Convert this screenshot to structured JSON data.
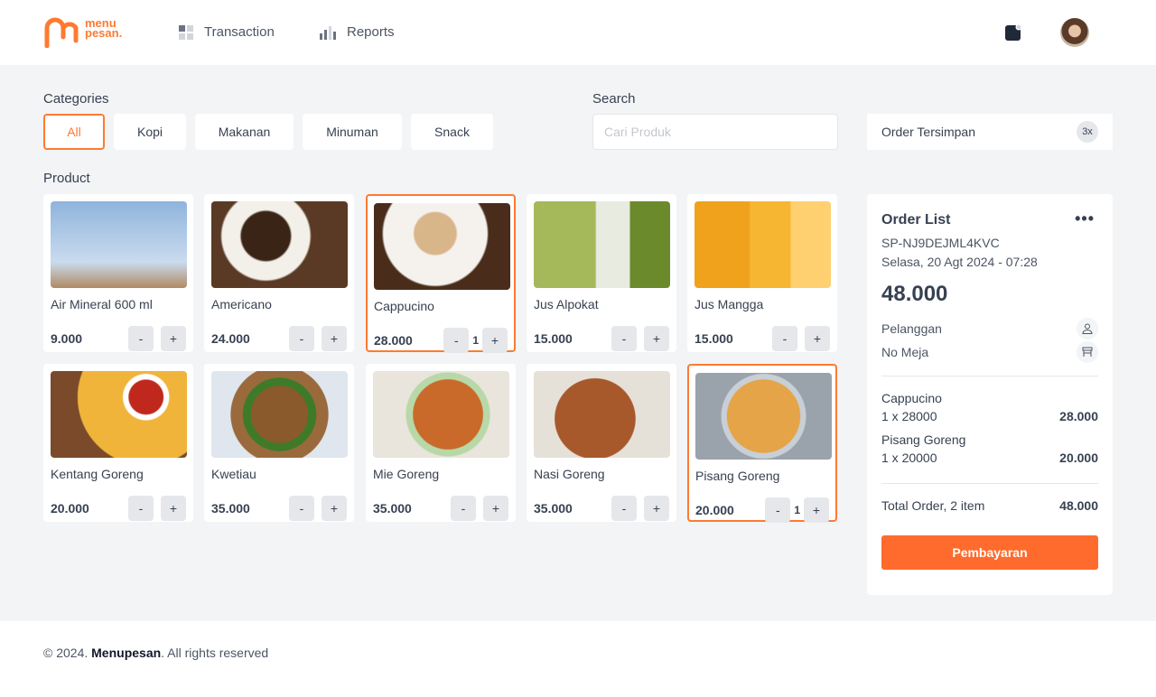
{
  "brand": {
    "logo_text_1": "menu",
    "logo_text_2": "pesan."
  },
  "nav": [
    {
      "label": "Transaction",
      "icon": "grid-icon"
    },
    {
      "label": "Reports",
      "icon": "bar-chart-icon"
    }
  ],
  "categories": {
    "label": "Categories",
    "items": [
      "All",
      "Kopi",
      "Makanan",
      "Minuman",
      "Snack"
    ],
    "active": "All"
  },
  "search": {
    "label": "Search",
    "placeholder": "Cari Produk",
    "value": ""
  },
  "saved_orders": {
    "label": "Order Tersimpan",
    "count": "3x"
  },
  "product_label": "Product",
  "products": [
    {
      "name": "Air Mineral 600 ml",
      "price": "9.000",
      "qty": ""
    },
    {
      "name": "Americano",
      "price": "24.000",
      "qty": ""
    },
    {
      "name": "Cappucino",
      "price": "28.000",
      "qty": "1"
    },
    {
      "name": "Jus Alpokat",
      "price": "15.000",
      "qty": ""
    },
    {
      "name": "Jus Mangga",
      "price": "15.000",
      "qty": ""
    },
    {
      "name": "Kentang Goreng",
      "price": "20.000",
      "qty": ""
    },
    {
      "name": "Kwetiau",
      "price": "35.000",
      "qty": ""
    },
    {
      "name": "Mie Goreng",
      "price": "35.000",
      "qty": ""
    },
    {
      "name": "Nasi Goreng",
      "price": "35.000",
      "qty": ""
    },
    {
      "name": "Pisang Goreng",
      "price": "20.000",
      "qty": "1"
    }
  ],
  "order": {
    "title": "Order List",
    "id": "SP-NJ9DEJML4KVC",
    "datetime": "Selasa, 20 Agt 2024 - 07:28",
    "total": "48.000",
    "customer_label": "Pelanggan",
    "table_label": "No Meja",
    "items": [
      {
        "name": "Cappucino",
        "detail": "1 x 28000",
        "subtotal": "28.000"
      },
      {
        "name": "Pisang Goreng",
        "detail": "1 x 20000",
        "subtotal": "20.000"
      }
    ],
    "summary_label": "Total Order, 2 item",
    "summary_total": "48.000",
    "pay_label": "Pembayaran"
  },
  "footer": {
    "prefix": "© 2024. ",
    "brand": "Menupesan",
    "suffix": ". All rights reserved"
  },
  "colors": {
    "accent": "#ff7a30",
    "background": "#f3f4f6"
  }
}
